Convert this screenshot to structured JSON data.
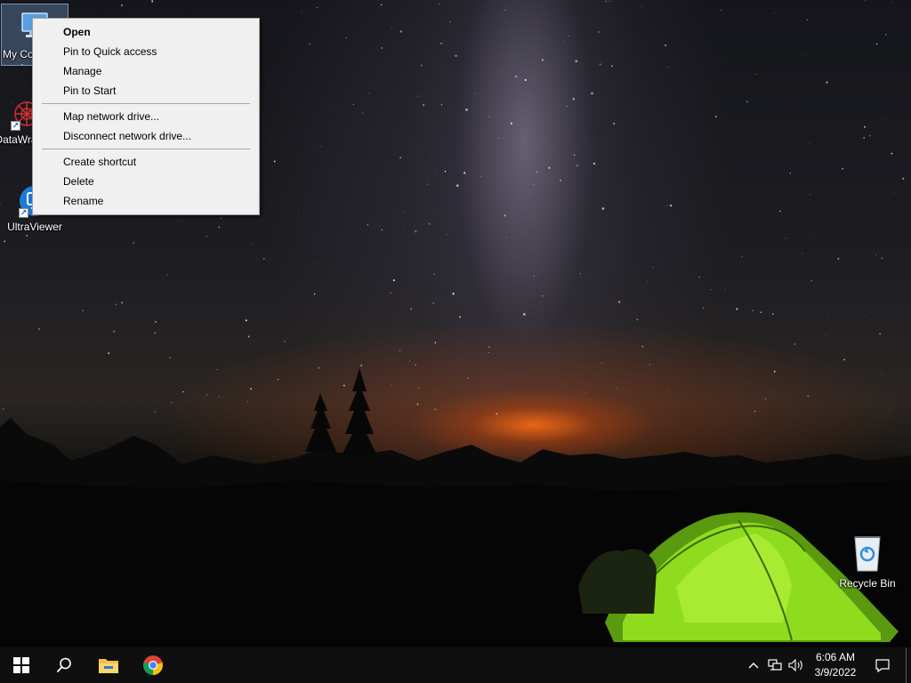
{
  "desktop": {
    "icons": [
      {
        "name": "my-computer",
        "label": "My Computer",
        "selected": true
      },
      {
        "name": "datawrapper",
        "label": "DataWrapper"
      },
      {
        "name": "ultraviewer",
        "label": "UltraViewer"
      },
      {
        "name": "recycle-bin",
        "label": "Recycle Bin"
      }
    ]
  },
  "context_menu": {
    "items": [
      {
        "label": "Open",
        "bold": true
      },
      {
        "label": "Pin to Quick access"
      },
      {
        "label": "Manage"
      },
      {
        "label": "Pin to Start"
      },
      {
        "label": "Map network drive..."
      },
      {
        "label": "Disconnect network drive..."
      },
      {
        "label": "Create shortcut"
      },
      {
        "label": "Delete"
      },
      {
        "label": "Rename"
      }
    ]
  },
  "taskbar": {
    "buttons": [
      {
        "icon": "windows-start-icon"
      },
      {
        "icon": "search-icon"
      },
      {
        "icon": "file-explorer-icon"
      },
      {
        "icon": "chrome-icon"
      }
    ],
    "tray": {
      "icons": [
        "chevron-up-icon",
        "network-icon",
        "volume-icon",
        "notification-icon"
      ],
      "time": "6:06 AM",
      "date": "3/9/2022"
    }
  },
  "colors": {
    "menu_background": "#f0f0f0",
    "taskbar_background": "#0f0f10",
    "tent_green": "#8fdc1e",
    "horizon_glow": "#ff6e14",
    "selection_highlight": "#78a0d2"
  }
}
